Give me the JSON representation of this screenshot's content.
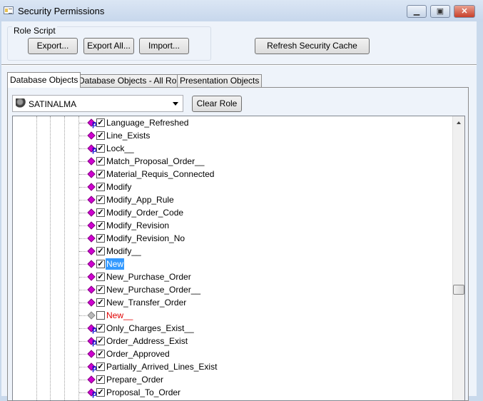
{
  "window": {
    "title": "Security Permissions",
    "controls": [
      "minimize",
      "maximize",
      "close"
    ]
  },
  "role_script": {
    "label": "Role Script",
    "export": "Export...",
    "export_all": "Export All...",
    "import": "Import..."
  },
  "refresh_label": "Refresh Security Cache",
  "tabs": [
    {
      "label": "Database Objects",
      "active": true
    },
    {
      "label": "Database Objects - All Roles",
      "active": false
    },
    {
      "label": "Presentation Objects",
      "active": false
    }
  ],
  "role_select": {
    "value": "SATINALMA",
    "icon": "role-icon"
  },
  "clear_role": "Clear Role",
  "tree_items": [
    {
      "label": "Language_Refreshed",
      "checked": true,
      "p": true
    },
    {
      "label": "Line_Exists",
      "checked": true,
      "p": false
    },
    {
      "label": "Lock__",
      "checked": true,
      "p": true
    },
    {
      "label": "Match_Proposal_Order__",
      "checked": true,
      "p": false
    },
    {
      "label": "Material_Requis_Connected",
      "checked": true,
      "p": false
    },
    {
      "label": "Modify",
      "checked": true,
      "p": false
    },
    {
      "label": "Modify_App_Rule",
      "checked": true,
      "p": false
    },
    {
      "label": "Modify_Order_Code",
      "checked": true,
      "p": false
    },
    {
      "label": "Modify_Revision",
      "checked": true,
      "p": false
    },
    {
      "label": "Modify_Revision_No",
      "checked": true,
      "p": false
    },
    {
      "label": "Modify__",
      "checked": true,
      "p": false
    },
    {
      "label": "New",
      "checked": true,
      "p": false,
      "selected": true
    },
    {
      "label": "New_Purchase_Order",
      "checked": true,
      "p": false
    },
    {
      "label": "New_Purchase_Order__",
      "checked": true,
      "p": false
    },
    {
      "label": "New_Transfer_Order",
      "checked": true,
      "p": false
    },
    {
      "label": "New__",
      "checked": false,
      "p": false,
      "disabled": true
    },
    {
      "label": "Only_Charges_Exist__",
      "checked": true,
      "p": true
    },
    {
      "label": "Order_Address_Exist",
      "checked": true,
      "p": true
    },
    {
      "label": "Order_Approved",
      "checked": true,
      "p": false
    },
    {
      "label": "Partially_Arrived_Lines_Exist",
      "checked": true,
      "p": true
    },
    {
      "label": "Prepare_Order",
      "checked": true,
      "p": false
    },
    {
      "label": "Proposal_To_Order",
      "checked": true,
      "p": true
    }
  ],
  "colors": {
    "selection": "#3399ff",
    "method_icon": "#d000d0",
    "unavailable_text": "#e00000"
  }
}
